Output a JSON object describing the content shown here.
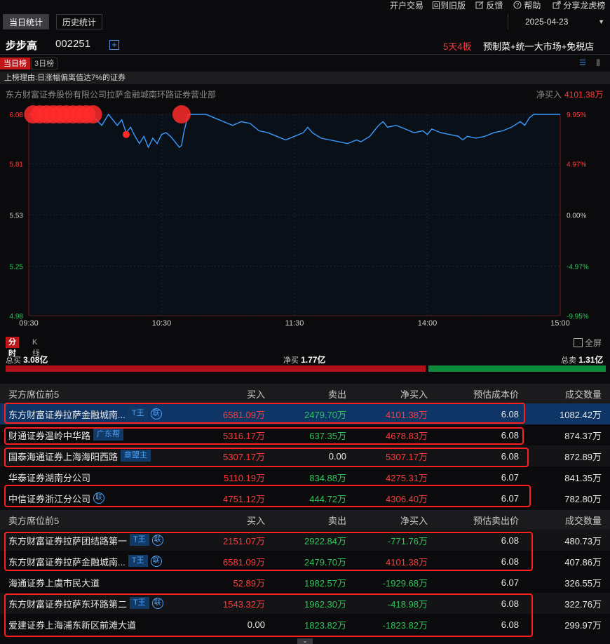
{
  "toplinks": [
    {
      "label": "开户交易",
      "icon": ""
    },
    {
      "label": "回到旧版",
      "icon": ""
    },
    {
      "label": "反馈",
      "icon": "edit-icon"
    },
    {
      "label": "帮助",
      "icon": "help-icon"
    },
    {
      "label": "分享龙虎榜",
      "icon": "share-icon"
    }
  ],
  "tabs": {
    "today": "当日统计",
    "history": "历史统计"
  },
  "date": "2025-04-23",
  "stock": {
    "name": "步步高",
    "code": "002251",
    "boards": "5天4板",
    "concepts": "预制菜+统一大市场+免税店"
  },
  "subtabs": {
    "today": "当日榜",
    "three_day": "3日榜"
  },
  "reason": "上榜理由:日涨幅偏离值达7%的证券",
  "branch": {
    "name": "东方财富证券股份有限公司拉萨金融城南环路证券营业部",
    "net_label": "净买入",
    "net_value": "4101.38万"
  },
  "chart_data": {
    "type": "line",
    "y_left_ticks": [
      "6.08",
      "5.81",
      "5.53",
      "5.25",
      "4.98"
    ],
    "y_right_ticks": [
      "9.95%",
      "4.97%",
      "0.00%",
      "-4.97%",
      "-9.95%"
    ],
    "x_ticks": [
      "09:30",
      "10:30",
      "11:30",
      "14:00",
      "15:00"
    ],
    "ylim": [
      4.98,
      6.08
    ],
    "xlim": [
      0,
      240
    ],
    "prev_close": 5.53,
    "price": [
      [
        0,
        6.08
      ],
      [
        2,
        6.08
      ],
      [
        5,
        6.06
      ],
      [
        6,
        6.08
      ],
      [
        10,
        6.08
      ],
      [
        18,
        6.08
      ],
      [
        28,
        6.08
      ],
      [
        33,
        6.02
      ],
      [
        36,
        6.08
      ],
      [
        38,
        6.05
      ],
      [
        40,
        6.02
      ],
      [
        42,
        6.05
      ],
      [
        44,
        5.98
      ],
      [
        46,
        6.01
      ],
      [
        48,
        5.96
      ],
      [
        50,
        5.92
      ],
      [
        52,
        5.96
      ],
      [
        54,
        5.9
      ],
      [
        56,
        5.95
      ],
      [
        58,
        5.92
      ],
      [
        60,
        5.97
      ],
      [
        62,
        5.98
      ],
      [
        64,
        5.96
      ],
      [
        66,
        5.93
      ],
      [
        68,
        5.9
      ],
      [
        69,
        5.91
      ],
      [
        70,
        5.98
      ],
      [
        72,
        6.08
      ],
      [
        74,
        6.08
      ],
      [
        80,
        6.08
      ],
      [
        84,
        6.06
      ],
      [
        88,
        6.04
      ],
      [
        92,
        6.02
      ],
      [
        96,
        6.04
      ],
      [
        100,
        6.03
      ],
      [
        104,
        5.99
      ],
      [
        108,
        5.98
      ],
      [
        112,
        5.96
      ],
      [
        116,
        5.94
      ],
      [
        120,
        5.96
      ],
      [
        124,
        5.98
      ],
      [
        126,
        6.01
      ],
      [
        128,
        5.98
      ],
      [
        132,
        5.95
      ],
      [
        136,
        5.94
      ],
      [
        140,
        5.93
      ],
      [
        144,
        5.92
      ],
      [
        148,
        5.94
      ],
      [
        150,
        5.93
      ],
      [
        154,
        5.96
      ],
      [
        156,
        5.99
      ],
      [
        158,
        6.02
      ],
      [
        160,
        6.04
      ],
      [
        162,
        6.01
      ],
      [
        166,
        6.02
      ],
      [
        170,
        6.0
      ],
      [
        174,
        5.98
      ],
      [
        178,
        5.99
      ],
      [
        180,
        5.97
      ],
      [
        182,
        6.0
      ],
      [
        186,
        5.98
      ],
      [
        190,
        5.97
      ],
      [
        194,
        5.96
      ],
      [
        196,
        5.94
      ],
      [
        198,
        5.96
      ],
      [
        202,
        5.95
      ],
      [
        206,
        5.96
      ],
      [
        210,
        5.98
      ],
      [
        214,
        5.99
      ],
      [
        218,
        6.01
      ],
      [
        222,
        6.04
      ],
      [
        224,
        6.02
      ],
      [
        226,
        6.06
      ],
      [
        228,
        6.08
      ],
      [
        232,
        6.08
      ],
      [
        240,
        6.08
      ]
    ],
    "markers": [
      [
        2,
        6.08
      ],
      [
        5,
        6.08
      ],
      [
        8,
        6.08
      ],
      [
        11,
        6.08
      ],
      [
        14,
        6.08
      ],
      [
        17,
        6.08
      ],
      [
        20,
        6.08
      ],
      [
        23,
        6.08
      ],
      [
        26,
        6.08
      ],
      [
        29,
        6.08
      ],
      [
        69,
        6.08
      ]
    ],
    "small_marker": [
      44,
      5.97
    ]
  },
  "chart_tabs": {
    "fenshi": "分时",
    "kline": "K线",
    "fullscreen": "全屏"
  },
  "totals": {
    "buy_label": "总买",
    "buy_value": "3.08亿",
    "net_label": "净买",
    "net_value": "1.77亿",
    "sell_label": "总卖",
    "sell_value": "1.31亿",
    "buy_fraction": 0.702
  },
  "buy_table": {
    "headers": [
      "买方席位前5",
      "买入",
      "卖出",
      "净买入",
      "预估成本价",
      "成交数量"
    ],
    "rows": [
      {
        "name": "东方财富证券拉萨金融城南...",
        "tag": "T王",
        "lian": "联",
        "buy": "6581.09万",
        "sell": "2479.70万",
        "net": "4101.38万",
        "price": "6.08",
        "volume": "1082.42万"
      },
      {
        "name": "财通证券温岭中华路",
        "tag": "广东帮",
        "lian": "",
        "buy": "5316.17万",
        "sell": "637.35万",
        "net": "4678.83万",
        "price": "6.08",
        "volume": "874.37万"
      },
      {
        "name": "国泰海通证券上海海阳西路",
        "tag": "章盟主",
        "lian": "",
        "buy": "5307.17万",
        "sell": "0.00",
        "net": "5307.17万",
        "price": "6.08",
        "volume": "872.89万"
      },
      {
        "name": "华泰证券湖南分公司",
        "tag": "",
        "lian": "",
        "buy": "5110.19万",
        "sell": "834.88万",
        "net": "4275.31万",
        "price": "6.07",
        "volume": "841.35万"
      },
      {
        "name": "中信证券浙江分公司",
        "tag": "",
        "lian": "联",
        "buy": "4751.12万",
        "sell": "444.72万",
        "net": "4306.40万",
        "price": "6.07",
        "volume": "782.80万"
      }
    ]
  },
  "sell_table": {
    "headers": [
      "卖方席位前5",
      "买入",
      "卖出",
      "净买入",
      "预估卖出价",
      "成交数量"
    ],
    "rows": [
      {
        "name": "东方财富证券拉萨团结路第一",
        "tag": "T王",
        "lian": "联",
        "buy": "2151.07万",
        "sell": "2922.84万",
        "net": "-771.76万",
        "price": "6.08",
        "volume": "480.73万"
      },
      {
        "name": "东方财富证券拉萨金融城南...",
        "tag": "T王",
        "lian": "联",
        "buy": "6581.09万",
        "sell": "2479.70万",
        "net": "4101.38万",
        "price": "6.08",
        "volume": "407.86万"
      },
      {
        "name": "海通证券上虞市民大道",
        "tag": "",
        "lian": "",
        "buy": "52.89万",
        "sell": "1982.57万",
        "net": "-1929.68万",
        "price": "6.07",
        "volume": "326.55万"
      },
      {
        "name": "东方财富证券拉萨东环路第二",
        "tag": "T王",
        "lian": "联",
        "buy": "1543.32万",
        "sell": "1962.30万",
        "net": "-418.98万",
        "price": "6.08",
        "volume": "322.76万"
      },
      {
        "name": "爱建证券上海浦东新区前滩大道",
        "tag": "",
        "lian": "",
        "buy": "0.00",
        "sell": "1823.82万",
        "net": "-1823.82万",
        "price": "6.08",
        "volume": "299.97万"
      }
    ]
  }
}
